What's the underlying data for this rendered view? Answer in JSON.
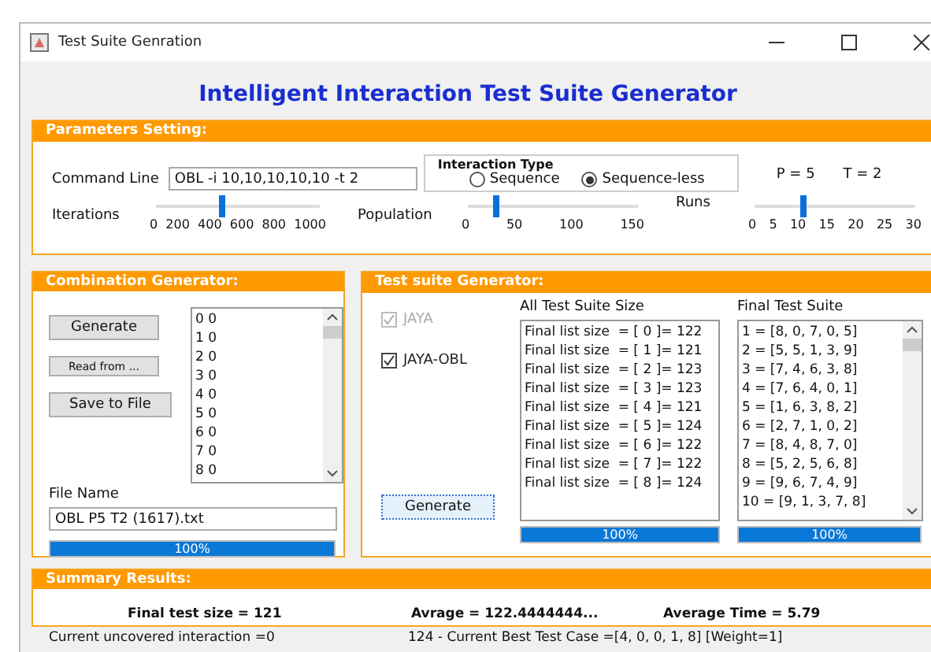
{
  "window": {
    "title": "Test Suite Genration"
  },
  "app_title": "Intelligent Interaction Test Suite Generator",
  "parameters": {
    "header": "Parameters Setting:",
    "command_line": {
      "label": "Command Line",
      "value": "OBL -i 10,10,10,10,10 -t 2"
    },
    "interaction_type": {
      "label": "Interaction Type",
      "options": [
        {
          "label": "Sequence",
          "selected": false
        },
        {
          "label": "Sequence-less",
          "selected": true
        }
      ]
    },
    "p": "P = 5",
    "t": "T = 2",
    "sliders": [
      {
        "label": "Iterations",
        "level": 0.4,
        "ticks": [
          "0",
          "200",
          "400",
          "600",
          "800",
          "1000"
        ]
      },
      {
        "label": "Population",
        "level": 0.17,
        "ticks": [
          "0",
          "50",
          "100",
          "150"
        ]
      },
      {
        "label": "Runs",
        "level": 0.3,
        "ticks": [
          "0",
          "5",
          "10",
          "15",
          "20",
          "25",
          "30"
        ]
      }
    ]
  },
  "combination": {
    "header": "Combination Generator:",
    "buttons": [
      {
        "label": "Generate",
        "kind": "normal"
      },
      {
        "label": "Read from ...",
        "kind": "small"
      },
      {
        "label": "Save to File",
        "kind": "normal"
      }
    ],
    "list": [
      "0 0",
      "1 0",
      "2 0",
      "3 0",
      "4 0",
      "5 0",
      "6 0",
      "7 0",
      "8 0"
    ],
    "file_name": {
      "label": "File Name",
      "value": "OBL P5 T2 (1617).txt"
    },
    "progress": {
      "level": 1,
      "text": "100%"
    }
  },
  "suite": {
    "header": "Test suite Generator:",
    "checkboxes": [
      {
        "label": "JAYA",
        "checked": true,
        "disabled": true
      },
      {
        "label": "JAYA-OBL",
        "checked": true,
        "disabled": false
      }
    ],
    "generate": "Generate",
    "all_sizes": {
      "heading": "All Test Suite Size",
      "items": [
        "Final list size  = [ 0 ]= 122",
        "Final list size  = [ 1 ]= 121",
        "Final list size  = [ 2 ]= 123",
        "Final list size  = [ 3 ]= 123",
        "Final list size  = [ 4 ]= 121",
        "Final list size  = [ 5 ]= 124",
        "Final list size  = [ 6 ]= 122",
        "Final list size  = [ 7 ]= 122",
        "Final list size  = [ 8 ]= 124"
      ],
      "progress": {
        "level": 1,
        "text": "100%"
      }
    },
    "final": {
      "heading": "Final Test Suite",
      "items": [
        "1 = [8, 0, 7, 0, 5]",
        "2 = [5, 5, 1, 3, 9]",
        "3 = [7, 4, 6, 3, 8]",
        "4 = [7, 6, 4, 0, 1]",
        "5 = [1, 6, 3, 8, 2]",
        "6 = [2, 7, 1, 0, 2]",
        "7 = [8, 4, 8, 7, 0]",
        "8 = [5, 2, 5, 6, 8]",
        "9 = [9, 6, 7, 4, 9]",
        "10 = [9, 1, 3, 7, 8]"
      ],
      "progress": {
        "level": 1,
        "text": "100%"
      }
    }
  },
  "summary": {
    "header": "Summary Results:",
    "items": [
      "Final test size = 121",
      "Avrage = 122.4444444...",
      "Average Time = 5.79"
    ]
  },
  "status": [
    "Current uncovered interaction =0",
    "124 - Current Best Test Case  =[4, 0, 0, 1, 8] [Weight=1]"
  ]
}
